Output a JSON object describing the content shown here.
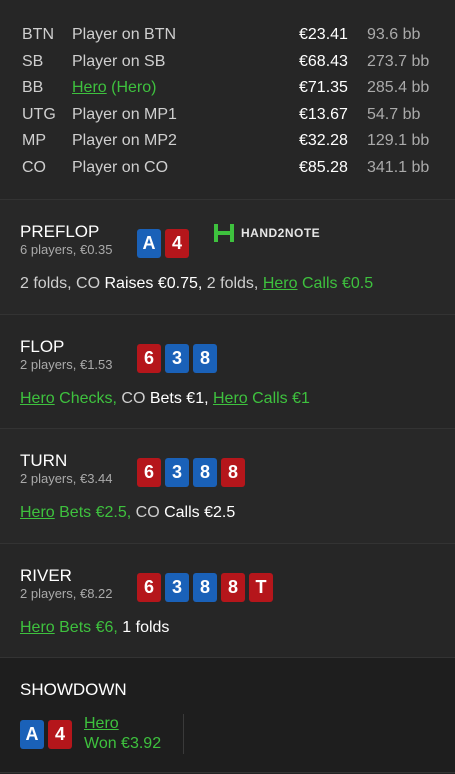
{
  "players": [
    {
      "pos": "BTN",
      "name": "Player on BTN",
      "stack": "€23.41",
      "bb": "93.6 bb"
    },
    {
      "pos": "SB",
      "name": "Player on SB",
      "stack": "€68.43",
      "bb": "273.7 bb"
    },
    {
      "pos": "BB",
      "name_link": "Hero",
      "name_suffix": " (Hero)",
      "stack": "€71.35",
      "bb": "285.4 bb"
    },
    {
      "pos": "UTG",
      "name": "Player on MP1",
      "stack": "€13.67",
      "bb": "54.7 bb"
    },
    {
      "pos": "MP",
      "name": "Player on MP2",
      "stack": "€32.28",
      "bb": "129.1 bb"
    },
    {
      "pos": "CO",
      "name": "Player on CO",
      "stack": "€85.28",
      "bb": "341.1 bb"
    }
  ],
  "logo": {
    "text": "HAND2NOTE",
    "icon": "h2n-logo-icon"
  },
  "streets": [
    {
      "name": "PREFLOP",
      "info": "6 players, €0.35",
      "cards": [
        {
          "rank": "A",
          "color": "b"
        },
        {
          "rank": "4",
          "color": "r"
        }
      ],
      "action": {
        "a1": "2 folds, CO ",
        "a2": "Raises €0.75,",
        "a3": " 2 folds, ",
        "hero": "Hero",
        "a4": " Calls €0.5"
      }
    },
    {
      "name": "FLOP",
      "info": "2 players, €1.53",
      "cards": [
        {
          "rank": "6",
          "color": "r"
        },
        {
          "rank": "3",
          "color": "b"
        },
        {
          "rank": "8",
          "color": "b"
        }
      ],
      "action": {
        "hero1": "Hero",
        "a1": " Checks,",
        "a2": " CO ",
        "a3": "Bets €1,",
        "hero2": "Hero",
        "a4": " Calls €1"
      }
    },
    {
      "name": "TURN",
      "info": "2 players, €3.44",
      "cards": [
        {
          "rank": "6",
          "color": "r"
        },
        {
          "rank": "3",
          "color": "b"
        },
        {
          "rank": "8",
          "color": "b"
        },
        {
          "rank": "8",
          "color": "r"
        }
      ],
      "action": {
        "hero": "Hero",
        "a1": " Bets €2.5,",
        "a2": " CO ",
        "a3": "Calls €2.5"
      }
    },
    {
      "name": "RIVER",
      "info": "2 players, €8.22",
      "cards": [
        {
          "rank": "6",
          "color": "r"
        },
        {
          "rank": "3",
          "color": "b"
        },
        {
          "rank": "8",
          "color": "b"
        },
        {
          "rank": "8",
          "color": "r"
        },
        {
          "rank": "T",
          "color": "r"
        }
      ],
      "action": {
        "hero": "Hero",
        "a1": " Bets €6,",
        "a2": " 1 folds"
      }
    }
  ],
  "showdown": {
    "title": "SHOWDOWN",
    "cards": [
      {
        "rank": "A",
        "color": "b"
      },
      {
        "rank": "4",
        "color": "r"
      }
    ],
    "player": "Hero",
    "result": "Won €3.92"
  }
}
